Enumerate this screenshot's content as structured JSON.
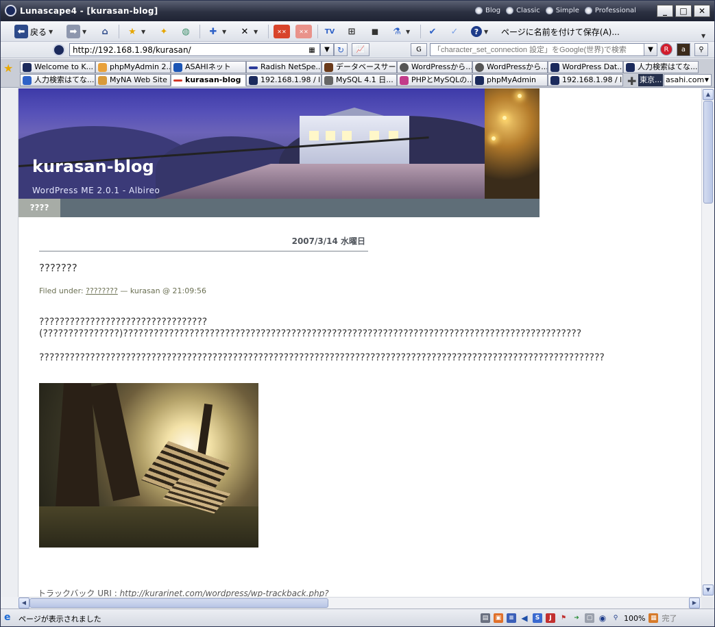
{
  "window": {
    "title": "Lunascape4 - [kurasan-blog]",
    "modes": [
      "Blog",
      "Classic",
      "Simple",
      "Professional"
    ],
    "buttons": {
      "minimize": "_",
      "maximize": "□",
      "close": "✕"
    }
  },
  "toolbar": {
    "back_label": "戻る",
    "save_label": "ページに名前を付けて保存(A)..."
  },
  "address": {
    "url": "http://192.168.1.98/kurasan/",
    "search_placeholder": "「character_set_connection 設定」をGoogle(世界)で検索"
  },
  "tabs": {
    "row1": [
      "Welcome to K...",
      "phpMyAdmin 2...",
      "ASAHIネット",
      "Radish NetSpe...",
      "データベースサー...",
      "WordPressから...",
      "WordPressから...",
      "WordPress Dat...",
      "人力検索はてな..."
    ],
    "row2": [
      "人力検索はてな...",
      "MyNA Web Site",
      "kurasan-blog",
      "192.168.1.98 / l...",
      "MySQL 4.1 日...",
      "PHPとMySQLの...",
      "phpMyAdmin",
      "192.168.1.98 / l..."
    ],
    "active": "kurasan-blog",
    "site_label": "東京...",
    "site_select": "asahi.com"
  },
  "page": {
    "blog_title": "kurasan-blog",
    "blog_subtitle": "WordPress ME 2.0.1 - Albireo",
    "nav_item": "????",
    "date_heading": "2007/3/14 水曜日",
    "post_title": "???????",
    "meta_prefix": "Filed under: ",
    "meta_category": "????????",
    "meta_suffix": " — kurasan @ 21:09:56",
    "body_line1": "?????????????????????????????????",
    "body_line2": "(???????????????)??????????????????????????????????????????????????????????????????????????????????????????",
    "body_line3": "???????????????????????????????????????????????????????????????????????????????????????????????????????????????",
    "trackback_label": "トラックバック URI : ",
    "trackback_url": "http://kurarinet.com/wordpress/wp-trackback.php?"
  },
  "status": {
    "text": "ページが表示されました",
    "zoom": "100%",
    "done": "完了"
  }
}
